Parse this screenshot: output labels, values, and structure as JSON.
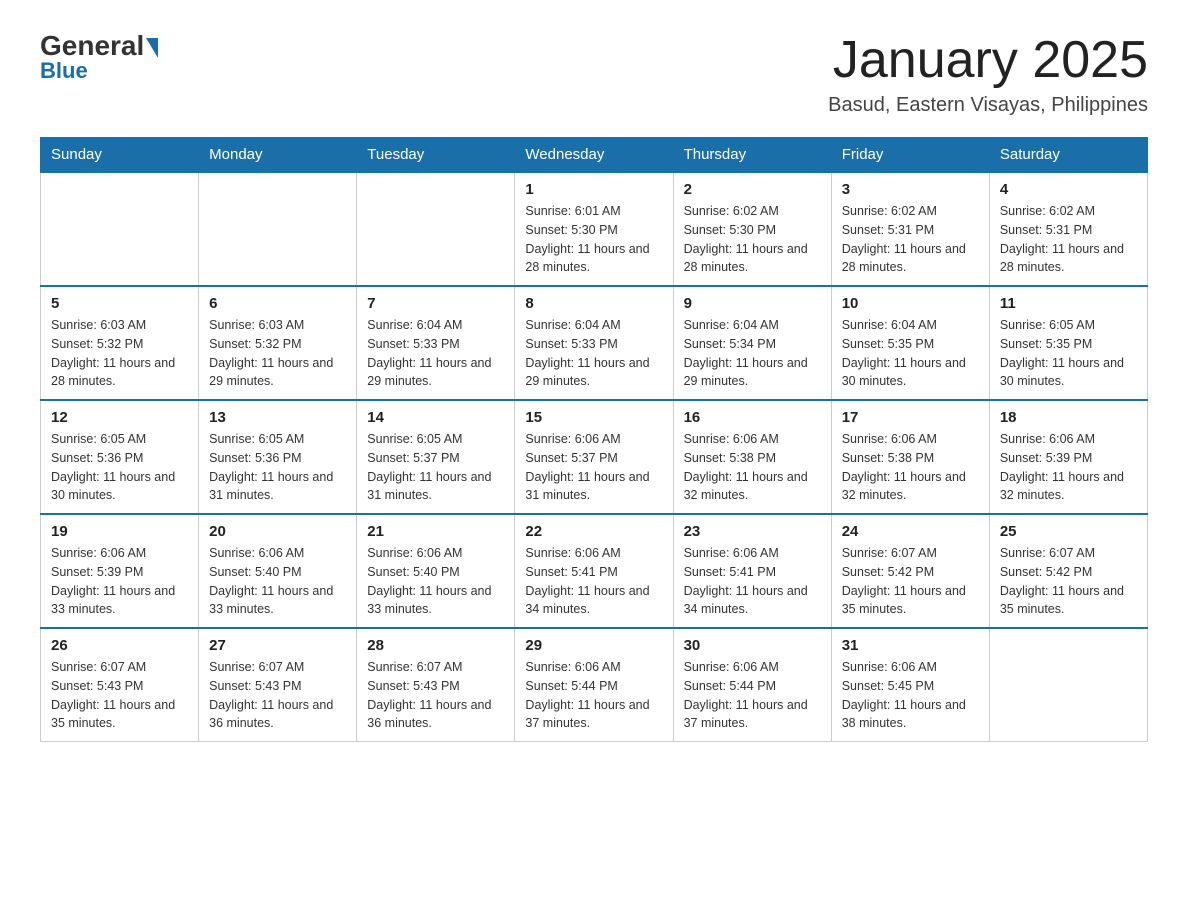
{
  "header": {
    "logo_general": "General",
    "logo_blue": "Blue",
    "title": "January 2025",
    "subtitle": "Basud, Eastern Visayas, Philippines"
  },
  "calendar": {
    "days_of_week": [
      "Sunday",
      "Monday",
      "Tuesday",
      "Wednesday",
      "Thursday",
      "Friday",
      "Saturday"
    ],
    "weeks": [
      [
        {
          "day": "",
          "info": ""
        },
        {
          "day": "",
          "info": ""
        },
        {
          "day": "",
          "info": ""
        },
        {
          "day": "1",
          "info": "Sunrise: 6:01 AM\nSunset: 5:30 PM\nDaylight: 11 hours and 28 minutes."
        },
        {
          "day": "2",
          "info": "Sunrise: 6:02 AM\nSunset: 5:30 PM\nDaylight: 11 hours and 28 minutes."
        },
        {
          "day": "3",
          "info": "Sunrise: 6:02 AM\nSunset: 5:31 PM\nDaylight: 11 hours and 28 minutes."
        },
        {
          "day": "4",
          "info": "Sunrise: 6:02 AM\nSunset: 5:31 PM\nDaylight: 11 hours and 28 minutes."
        }
      ],
      [
        {
          "day": "5",
          "info": "Sunrise: 6:03 AM\nSunset: 5:32 PM\nDaylight: 11 hours and 28 minutes."
        },
        {
          "day": "6",
          "info": "Sunrise: 6:03 AM\nSunset: 5:32 PM\nDaylight: 11 hours and 29 minutes."
        },
        {
          "day": "7",
          "info": "Sunrise: 6:04 AM\nSunset: 5:33 PM\nDaylight: 11 hours and 29 minutes."
        },
        {
          "day": "8",
          "info": "Sunrise: 6:04 AM\nSunset: 5:33 PM\nDaylight: 11 hours and 29 minutes."
        },
        {
          "day": "9",
          "info": "Sunrise: 6:04 AM\nSunset: 5:34 PM\nDaylight: 11 hours and 29 minutes."
        },
        {
          "day": "10",
          "info": "Sunrise: 6:04 AM\nSunset: 5:35 PM\nDaylight: 11 hours and 30 minutes."
        },
        {
          "day": "11",
          "info": "Sunrise: 6:05 AM\nSunset: 5:35 PM\nDaylight: 11 hours and 30 minutes."
        }
      ],
      [
        {
          "day": "12",
          "info": "Sunrise: 6:05 AM\nSunset: 5:36 PM\nDaylight: 11 hours and 30 minutes."
        },
        {
          "day": "13",
          "info": "Sunrise: 6:05 AM\nSunset: 5:36 PM\nDaylight: 11 hours and 31 minutes."
        },
        {
          "day": "14",
          "info": "Sunrise: 6:05 AM\nSunset: 5:37 PM\nDaylight: 11 hours and 31 minutes."
        },
        {
          "day": "15",
          "info": "Sunrise: 6:06 AM\nSunset: 5:37 PM\nDaylight: 11 hours and 31 minutes."
        },
        {
          "day": "16",
          "info": "Sunrise: 6:06 AM\nSunset: 5:38 PM\nDaylight: 11 hours and 32 minutes."
        },
        {
          "day": "17",
          "info": "Sunrise: 6:06 AM\nSunset: 5:38 PM\nDaylight: 11 hours and 32 minutes."
        },
        {
          "day": "18",
          "info": "Sunrise: 6:06 AM\nSunset: 5:39 PM\nDaylight: 11 hours and 32 minutes."
        }
      ],
      [
        {
          "day": "19",
          "info": "Sunrise: 6:06 AM\nSunset: 5:39 PM\nDaylight: 11 hours and 33 minutes."
        },
        {
          "day": "20",
          "info": "Sunrise: 6:06 AM\nSunset: 5:40 PM\nDaylight: 11 hours and 33 minutes."
        },
        {
          "day": "21",
          "info": "Sunrise: 6:06 AM\nSunset: 5:40 PM\nDaylight: 11 hours and 33 minutes."
        },
        {
          "day": "22",
          "info": "Sunrise: 6:06 AM\nSunset: 5:41 PM\nDaylight: 11 hours and 34 minutes."
        },
        {
          "day": "23",
          "info": "Sunrise: 6:06 AM\nSunset: 5:41 PM\nDaylight: 11 hours and 34 minutes."
        },
        {
          "day": "24",
          "info": "Sunrise: 6:07 AM\nSunset: 5:42 PM\nDaylight: 11 hours and 35 minutes."
        },
        {
          "day": "25",
          "info": "Sunrise: 6:07 AM\nSunset: 5:42 PM\nDaylight: 11 hours and 35 minutes."
        }
      ],
      [
        {
          "day": "26",
          "info": "Sunrise: 6:07 AM\nSunset: 5:43 PM\nDaylight: 11 hours and 35 minutes."
        },
        {
          "day": "27",
          "info": "Sunrise: 6:07 AM\nSunset: 5:43 PM\nDaylight: 11 hours and 36 minutes."
        },
        {
          "day": "28",
          "info": "Sunrise: 6:07 AM\nSunset: 5:43 PM\nDaylight: 11 hours and 36 minutes."
        },
        {
          "day": "29",
          "info": "Sunrise: 6:06 AM\nSunset: 5:44 PM\nDaylight: 11 hours and 37 minutes."
        },
        {
          "day": "30",
          "info": "Sunrise: 6:06 AM\nSunset: 5:44 PM\nDaylight: 11 hours and 37 minutes."
        },
        {
          "day": "31",
          "info": "Sunrise: 6:06 AM\nSunset: 5:45 PM\nDaylight: 11 hours and 38 minutes."
        },
        {
          "day": "",
          "info": ""
        }
      ]
    ]
  }
}
